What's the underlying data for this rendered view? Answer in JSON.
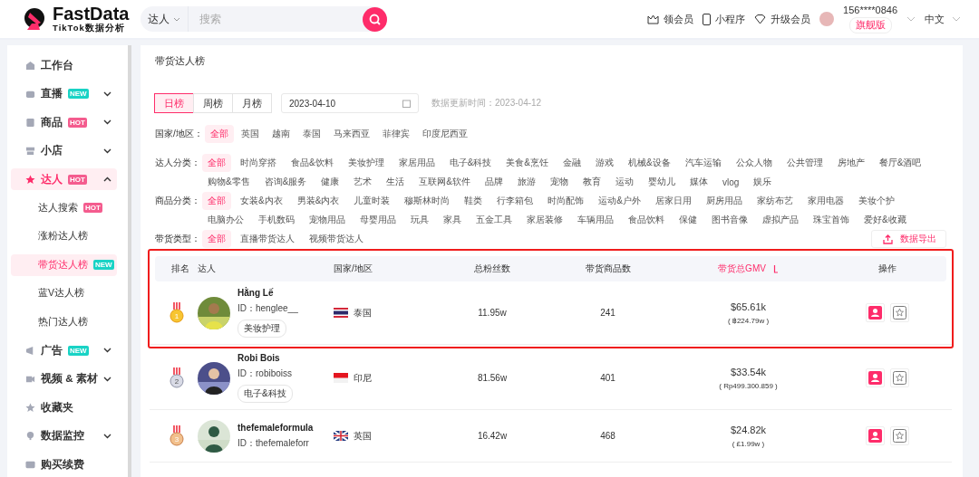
{
  "header": {
    "logo": {
      "name": "FastData",
      "subtitle": "TikTok数据分析"
    },
    "search": {
      "scope": "达人",
      "placeholder": "搜索"
    },
    "links": [
      {
        "kind": "crown",
        "label": "领会员"
      },
      {
        "kind": "phone",
        "label": "小程序"
      },
      {
        "kind": "diamond",
        "label": "升级会员"
      }
    ],
    "user": {
      "phone": "156****0846",
      "plan": "旗舰版"
    },
    "language": "中文"
  },
  "sidebar": {
    "items": [
      {
        "label": "工作台"
      },
      {
        "label": "直播",
        "badge": {
          "label": "NEW",
          "color": "#19d3c5"
        },
        "expanded": false
      },
      {
        "label": "商品",
        "badge": {
          "label": "HOT",
          "color": "#f45c8e"
        },
        "expanded": false
      },
      {
        "label": "小店",
        "expanded": false
      },
      {
        "label": "达人",
        "badge": {
          "label": "HOT",
          "color": "#f45c8e"
        },
        "expanded": true,
        "selected": true,
        "children": [
          {
            "label": "达人搜索",
            "badge": {
              "label": "HOT",
              "color": "#f45c8e"
            },
            "selected": false
          },
          {
            "label": "涨粉达人榜",
            "selected": false
          },
          {
            "label": "带货达人榜",
            "badge": {
              "label": "NEW",
              "color": "#19d3c5"
            },
            "selected": true
          },
          {
            "label": "蓝V达人榜",
            "selected": false
          },
          {
            "label": "热门达人榜",
            "selected": false
          }
        ]
      },
      {
        "label": "广告",
        "badge": {
          "label": "NEW",
          "color": "#19d3c5"
        },
        "expanded": false
      },
      {
        "label": "视频 & 素材",
        "expanded": false
      },
      {
        "label": "收藏夹"
      },
      {
        "label": "数据监控",
        "expanded": false
      },
      {
        "label": "购买续费"
      }
    ]
  },
  "page": {
    "title": "带货达人榜",
    "period_tabs": [
      {
        "label": "日榜",
        "selected": true
      },
      {
        "label": "周榜",
        "selected": false
      },
      {
        "label": "月榜",
        "selected": false
      }
    ],
    "date": "2023-04-10",
    "updated": "数据更新时间：2023-04-12",
    "filters": [
      {
        "label": "国家/地区：",
        "options": [
          {
            "label": "全部",
            "selected": true
          },
          {
            "label": "英国",
            "selected": false
          },
          {
            "label": "越南",
            "selected": false
          },
          {
            "label": "泰国",
            "selected": false
          },
          {
            "label": "马来西亚",
            "selected": false
          },
          {
            "label": "菲律宾",
            "selected": false
          },
          {
            "label": "印度尼西亚",
            "selected": false
          }
        ]
      },
      {
        "label": "达人分类：",
        "options": [
          {
            "label": "全部",
            "selected": true
          },
          {
            "label": "时尚穿搭",
            "selected": false
          },
          {
            "label": "食品&饮料",
            "selected": false
          },
          {
            "label": "美妆护理",
            "selected": false
          },
          {
            "label": "家居用品",
            "selected": false
          },
          {
            "label": "电子&科技",
            "selected": false
          },
          {
            "label": "美食&烹饪",
            "selected": false
          },
          {
            "label": "金融",
            "selected": false
          },
          {
            "label": "游戏",
            "selected": false
          },
          {
            "label": "机械&设备",
            "selected": false
          },
          {
            "label": "汽车运输",
            "selected": false
          },
          {
            "label": "公众人物",
            "selected": false
          },
          {
            "label": "公共管理",
            "selected": false
          },
          {
            "label": "房地产",
            "selected": false
          },
          {
            "label": "餐厅&酒吧",
            "selected": false
          },
          {
            "label": "购物&零售",
            "selected": false
          },
          {
            "label": "咨询&服务",
            "selected": false
          },
          {
            "label": "健康",
            "selected": false
          },
          {
            "label": "艺术",
            "selected": false
          },
          {
            "label": "生活",
            "selected": false
          },
          {
            "label": "互联网&软件",
            "selected": false
          },
          {
            "label": "品牌",
            "selected": false
          },
          {
            "label": "旅游",
            "selected": false
          },
          {
            "label": "宠物",
            "selected": false
          },
          {
            "label": "教育",
            "selected": false
          },
          {
            "label": "运动",
            "selected": false
          },
          {
            "label": "婴幼儿",
            "selected": false
          },
          {
            "label": "媒体",
            "selected": false
          },
          {
            "label": "vlog",
            "selected": false
          },
          {
            "label": "娱乐",
            "selected": false
          }
        ]
      },
      {
        "label": "商品分类：",
        "options": [
          {
            "label": "全部",
            "selected": true
          },
          {
            "label": "女装&内衣",
            "selected": false
          },
          {
            "label": "男装&内衣",
            "selected": false
          },
          {
            "label": "儿童时装",
            "selected": false
          },
          {
            "label": "穆斯林时尚",
            "selected": false
          },
          {
            "label": "鞋类",
            "selected": false
          },
          {
            "label": "行李箱包",
            "selected": false
          },
          {
            "label": "时尚配饰",
            "selected": false
          },
          {
            "label": "运动&户外",
            "selected": false
          },
          {
            "label": "居家日用",
            "selected": false
          },
          {
            "label": "厨房用品",
            "selected": false
          },
          {
            "label": "家纺布艺",
            "selected": false
          },
          {
            "label": "家用电器",
            "selected": false
          },
          {
            "label": "美妆个护",
            "selected": false
          },
          {
            "label": "电脑办公",
            "selected": false
          },
          {
            "label": "手机数码",
            "selected": false
          },
          {
            "label": "宠物用品",
            "selected": false
          },
          {
            "label": "母婴用品",
            "selected": false
          },
          {
            "label": "玩具",
            "selected": false
          },
          {
            "label": "家具",
            "selected": false
          },
          {
            "label": "五金工具",
            "selected": false
          },
          {
            "label": "家居装修",
            "selected": false
          },
          {
            "label": "车辆用品",
            "selected": false
          },
          {
            "label": "食品饮料",
            "selected": false
          },
          {
            "label": "保健",
            "selected": false
          },
          {
            "label": "图书音像",
            "selected": false
          },
          {
            "label": "虚拟产品",
            "selected": false
          },
          {
            "label": "珠宝首饰",
            "selected": false
          },
          {
            "label": "爱好&收藏",
            "selected": false
          }
        ]
      },
      {
        "label": "带货类型：",
        "options": [
          {
            "label": "全部",
            "selected": true
          },
          {
            "label": "直播带货达人",
            "selected": false
          },
          {
            "label": "视频带货达人",
            "selected": false
          }
        ]
      }
    ],
    "export_button": "数据导出",
    "table": {
      "highlight_frame": true,
      "columns": [
        {
          "label": "排名",
          "sorted": false
        },
        {
          "label": "达人",
          "sorted": false
        },
        {
          "label": "国家/地区",
          "sorted": false
        },
        {
          "label": "总粉丝数",
          "sorted": false
        },
        {
          "label": "带货商品数",
          "sorted": false
        },
        {
          "label": "带货总GMV",
          "sorted": true
        },
        {
          "label": "操作",
          "sorted": false
        }
      ],
      "rows": [
        {
          "rank": "1",
          "name": "Hằng Lế",
          "id": "ID：henglee__",
          "tag": "美妆护理",
          "country": "泰国",
          "fans": "11.95w",
          "products": "241",
          "gmv": "$65.61k",
          "gmv_local": "( ฿224.79w )"
        },
        {
          "rank": "2",
          "name": "Robi Bois",
          "id": "ID：robiboiss",
          "tag": "电子&科技",
          "country": "印尼",
          "fans": "81.56w",
          "products": "401",
          "gmv": "$33.54k",
          "gmv_local": "( Rp499.300.859 )"
        },
        {
          "rank": "3",
          "name": "thefemaleformula",
          "id": "ID：thefemaleforr",
          "country": "英国",
          "fans": "16.42w",
          "products": "468",
          "gmv": "$24.82k",
          "gmv_local": "( £1.99w )"
        }
      ]
    }
  }
}
